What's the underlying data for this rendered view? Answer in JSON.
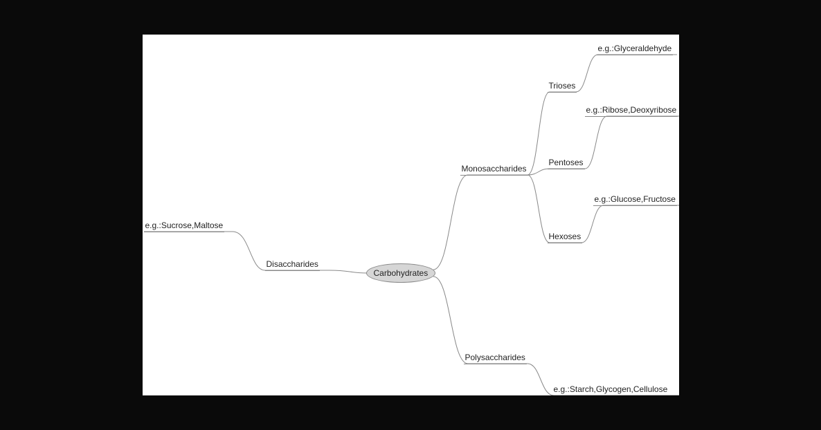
{
  "diagram": {
    "root": {
      "label": "Carbohydrates"
    },
    "left": {
      "disaccharides": {
        "label": "Disaccharides",
        "example": {
          "label": "e.g.:Sucrose,Maltose"
        }
      }
    },
    "right": {
      "monosaccharides": {
        "label": "Monosaccharides",
        "children": {
          "trioses": {
            "label": "Trioses",
            "example": {
              "label": "e.g.:Glyceraldehyde"
            }
          },
          "pentoses": {
            "label": "Pentoses",
            "example": {
              "label": "e.g.:Ribose,Deoxyribose"
            }
          },
          "hexoses": {
            "label": "Hexoses",
            "example": {
              "label": "e.g.:Glucose,Fructose"
            }
          }
        }
      },
      "polysaccharides": {
        "label": "Polysaccharides",
        "example": {
          "label": "e.g.:Starch,Glycogen,Cellulose"
        }
      }
    }
  },
  "colors": {
    "connector": "#888888",
    "rootFill": "#d6d6d6",
    "background": "#ffffff",
    "page": "#0a0a0a"
  }
}
